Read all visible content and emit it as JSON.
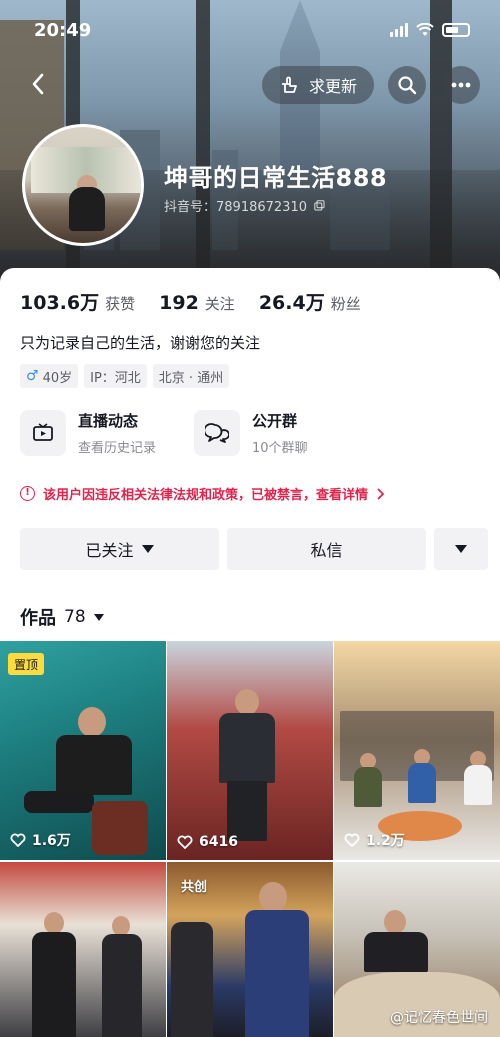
{
  "status_bar": {
    "time": "20:49"
  },
  "header": {
    "request_update_label": "求更新",
    "name": "坤哥的日常生活888",
    "uid": "抖音号：78918672310"
  },
  "stats": [
    {
      "value": "103.6万",
      "label": "获赞"
    },
    {
      "value": "192",
      "label": "关注"
    },
    {
      "value": "26.4万",
      "label": "粉丝"
    }
  ],
  "bio": "只为记录自己的生活，谢谢您的关注",
  "tags": {
    "age": "40岁",
    "ip": "IP：河北",
    "location": "北京 · 通州"
  },
  "entries": [
    {
      "title": "直播动态",
      "subtitle": "查看历史记录",
      "icon": "live-tv-icon"
    },
    {
      "title": "公开群",
      "subtitle": "10个群聊",
      "icon": "group-chat-icon"
    }
  ],
  "warning": "该用户因违反相关法律法规和政策，已被禁言，查看详情",
  "actions": {
    "follow_label": "已关注",
    "message_label": "私信"
  },
  "works": {
    "label": "作品",
    "count": "78"
  },
  "videos": [
    {
      "badge": "置顶",
      "likes": "1.6万"
    },
    {
      "badge": "",
      "likes": "6416"
    },
    {
      "badge": "",
      "likes": "1.2万"
    },
    {
      "badge": "",
      "likes": ""
    },
    {
      "badge": "共创",
      "likes": ""
    },
    {
      "badge": "",
      "likes": ""
    }
  ],
  "watermark": "@记忆春色世间",
  "colors": {
    "warning": "#e5234a",
    "pin_badge": "#fcdc3c",
    "male": "#3a8ef0"
  }
}
